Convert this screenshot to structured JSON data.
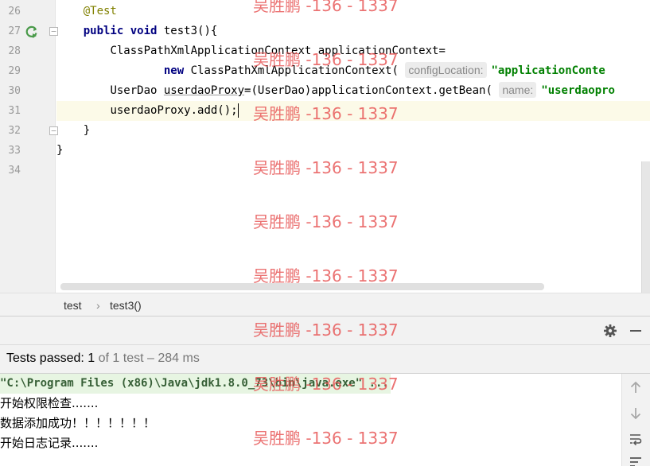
{
  "editor": {
    "line_numbers": [
      "26",
      "27",
      "28",
      "29",
      "30",
      "31",
      "32",
      "33",
      "34"
    ],
    "lines": {
      "l26": {
        "annotation": "@Test"
      },
      "l27": {
        "kw_public": "public",
        "kw_void": "void",
        "rest": " test3(){"
      },
      "l28": {
        "text": "ClassPathXmlApplicationContext applicationContext="
      },
      "l29": {
        "kw_new": "new",
        "call": " ClassPathXmlApplicationContext(",
        "hint": "configLocation:",
        "string": "\"applicationConte"
      },
      "l30": {
        "type": "UserDao ",
        "var": "userdaoProxy",
        "mid": "=(UserDao)applicationContext.getBean(",
        "hint": "name:",
        "string": "\"userdaopro"
      },
      "l31": {
        "before_caret": "userdaoProxy.add();"
      },
      "l32": {
        "text": "}"
      },
      "l33": {
        "text": "}"
      }
    }
  },
  "breadcrumb": {
    "items": [
      "test",
      "test3()"
    ],
    "separator": "›"
  },
  "run_panel": {
    "status_label": "Tests passed:",
    "passed_count": "1",
    "summary": "of 1 test – 284 ms",
    "console_lines": [
      "\"C:\\Program Files (x86)\\Java\\jdk1.8.0_73\\bin\\java.exe\" ...",
      "开始权限检查.......",
      "数据添加成功！！！！！！！",
      "开始日志记录......."
    ]
  },
  "watermark": {
    "text": "吴胜鹏 -136 - 1337"
  },
  "colors": {
    "accent_green": "#4a9a4a",
    "keyword": "#000080",
    "string": "#008000",
    "annotation": "#808000",
    "watermark": "#e75353"
  },
  "icons": [
    "run-test-icon",
    "fold-marker-icon",
    "gear-icon",
    "minimize-icon",
    "arrow-up-icon",
    "arrow-down-icon",
    "soft-wrap-icon",
    "sort-icon"
  ]
}
